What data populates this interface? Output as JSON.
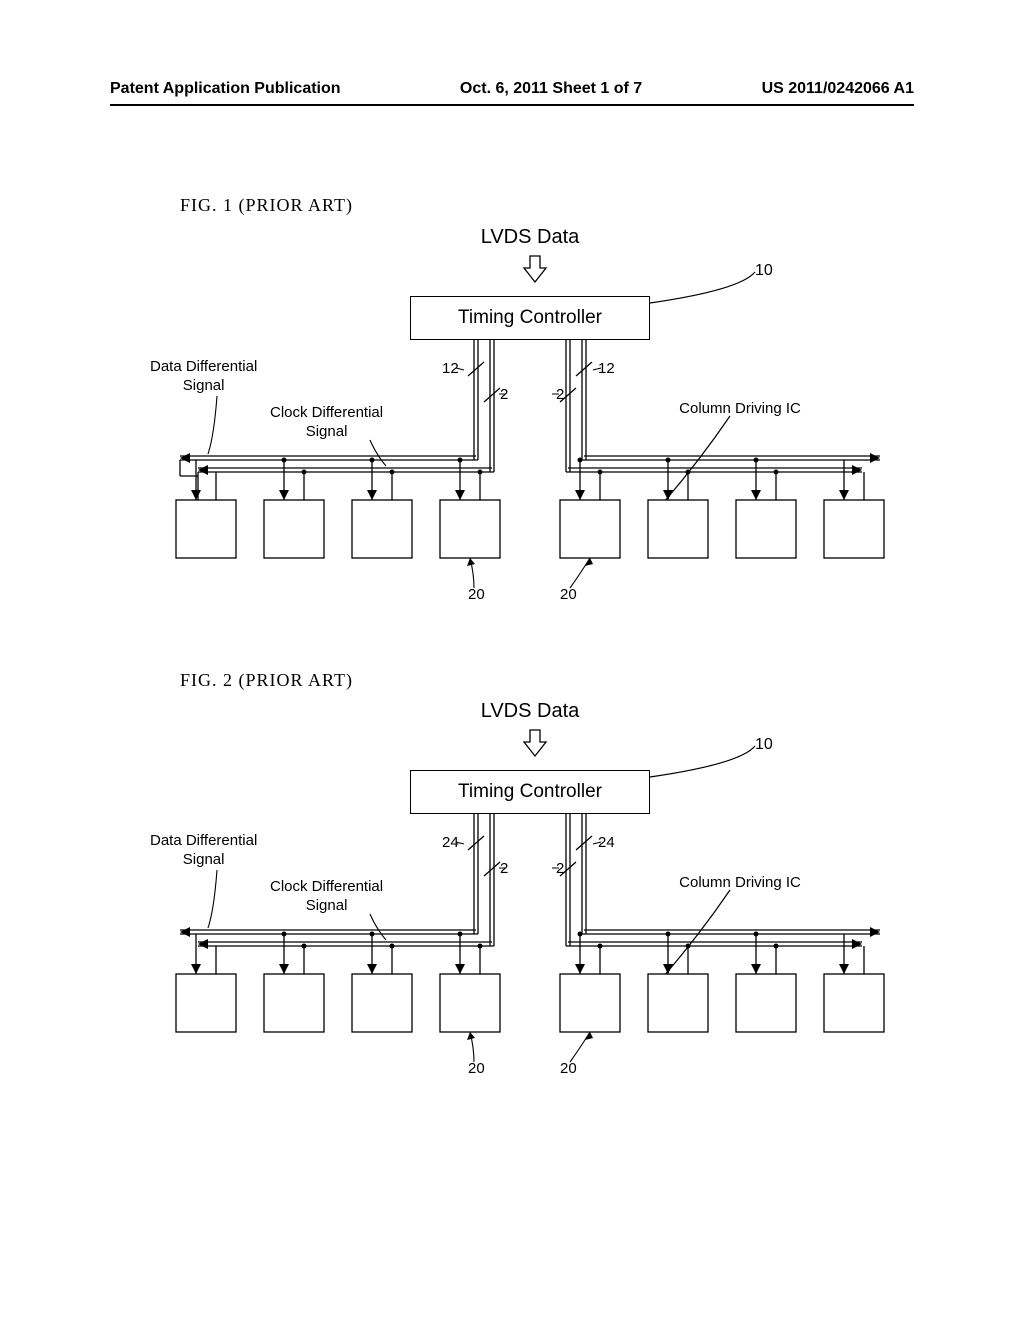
{
  "header": {
    "left": "Patent Application Publication",
    "center": "Oct. 6, 2011   Sheet 1 of 7",
    "right": "US 2011/0242066 A1"
  },
  "fig1": {
    "title": "FIG. 1 (PRIOR ART)",
    "lvds": "LVDS Data",
    "timing_controller": "Timing Controller",
    "data_diff": "Data Differential\nSignal",
    "clock_diff": "Clock Differential\nSignal",
    "col_ic": "Column Driving IC",
    "count_left": "12",
    "count_right": "12",
    "bus_left": "2",
    "bus_right": "2",
    "ref_tc": "10",
    "ref_ic_l": "20",
    "ref_ic_r": "20"
  },
  "fig2": {
    "title": "FIG. 2 (PRIOR ART)",
    "lvds": "LVDS Data",
    "timing_controller": "Timing Controller",
    "data_diff": "Data Differential\nSignal",
    "clock_diff": "Clock Differential\nSignal",
    "col_ic": "Column Driving IC",
    "count_left": "24",
    "count_right": "24",
    "bus_left": "2",
    "bus_right": "2",
    "ref_tc": "10",
    "ref_ic_l": "20",
    "ref_ic_r": "20"
  }
}
